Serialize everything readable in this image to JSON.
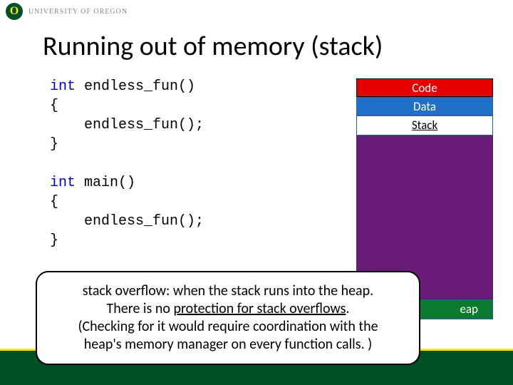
{
  "header": {
    "logo_letter": "O",
    "university": "UNIVERSITY OF OREGON"
  },
  "title": "Running out of memory (stack)",
  "code": {
    "kw_int_1": "int",
    "fn1_sig": " endless_fun()",
    "open1": "{",
    "call1": "    endless_fun();",
    "close1": "}",
    "kw_int_2": "int",
    "fn2_sig": " main()",
    "open2": "{",
    "call2": "    endless_fun();",
    "close2": "}"
  },
  "memory": {
    "code": "Code",
    "data": "Data",
    "stack": "Stack",
    "heap": "eap"
  },
  "callout": {
    "line1a": "stack overflow: when the stack runs into the heap.",
    "line2a": "There is no ",
    "line2b": "protection for stack overflows",
    "line2c": ".",
    "line3": "(Checking for it would require coordination with the",
    "line4": "heap's memory manager on every function calls. )"
  }
}
